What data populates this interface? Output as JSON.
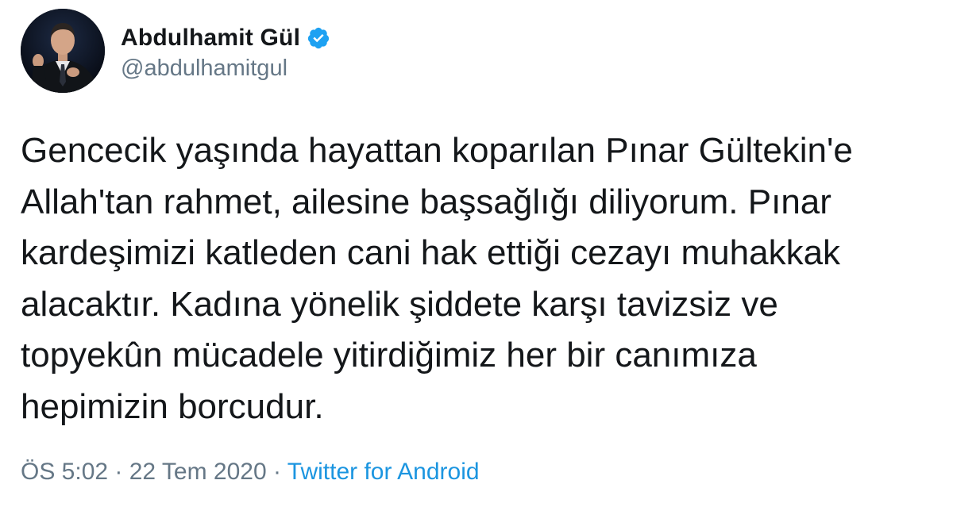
{
  "user": {
    "display_name": "Abdulhamit Gül",
    "handle": "@abdulhamitgul",
    "verified_icon": "verified-badge-icon",
    "colors": {
      "verified": "#1da1f2"
    }
  },
  "tweet": {
    "lines": [
      "Gencecik yaşında hayattan koparılan Pınar Gültekin'e",
      "Allah'tan rahmet, ailesine başsağlığı diliyorum. Pınar",
      "kardeşimizi katleden cani hak ettiği cezayı muhakkak",
      "alacaktır. Kadına yönelik şiddete karşı tavizsiz ve",
      "topyekûn mücadele yitirdiğimiz her bir canımıza",
      "hepimizin borcudur."
    ]
  },
  "meta": {
    "time": "ÖS 5:02",
    "separator": " · ",
    "date": "22 Tem 2020",
    "source": "Twitter for Android",
    "colors": {
      "muted": "#657786",
      "link": "#1b95e0"
    }
  }
}
